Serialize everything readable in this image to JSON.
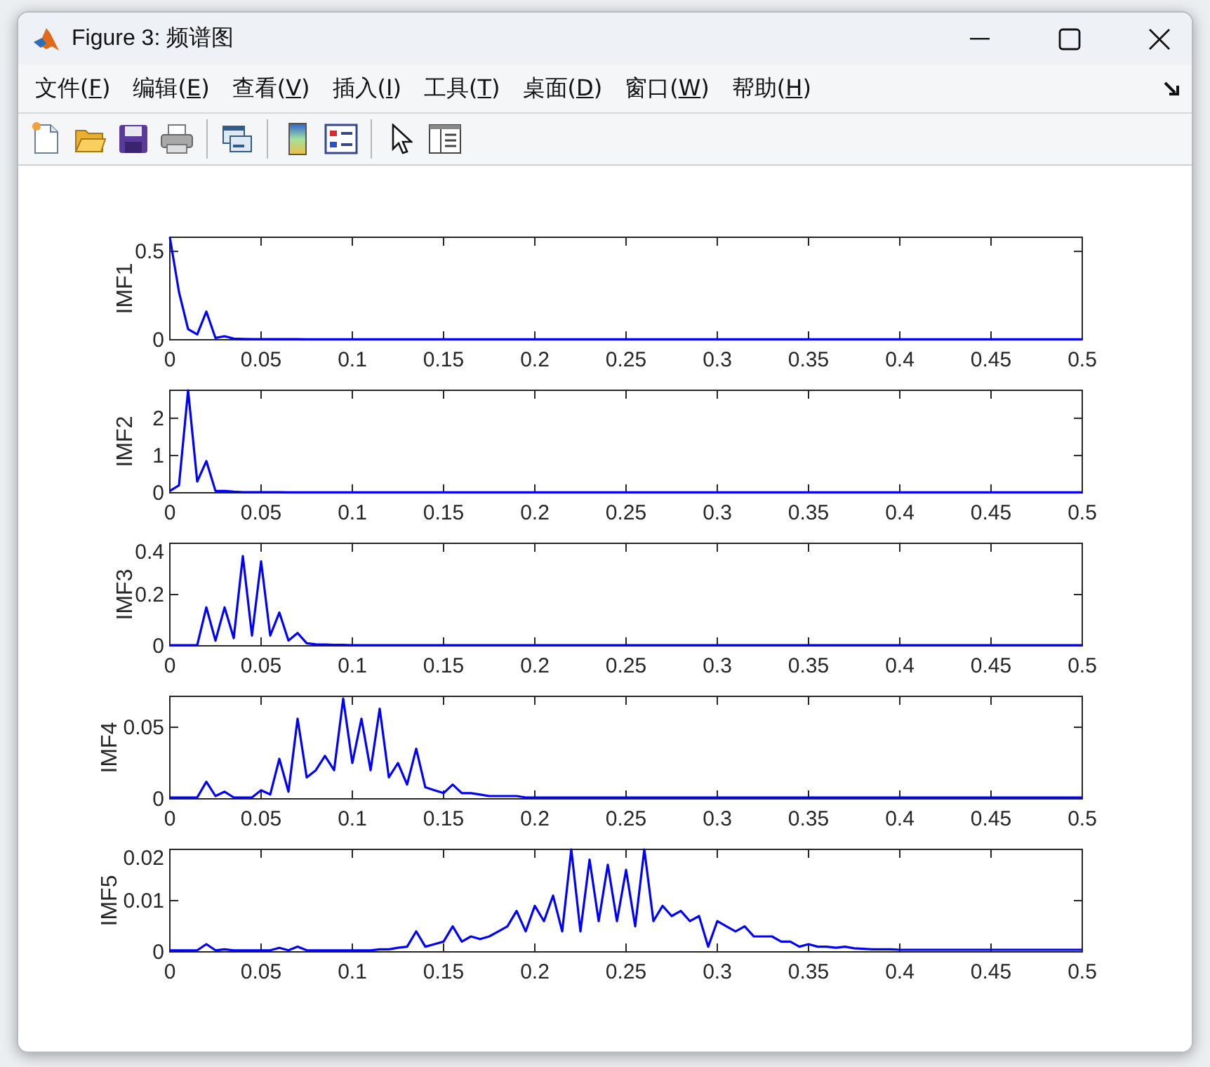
{
  "window": {
    "title": "Figure 3: 频谱图"
  },
  "menu": [
    {
      "label": "文件(F)"
    },
    {
      "label": "编辑(E)"
    },
    {
      "label": "查看(V)"
    },
    {
      "label": "插入(I)"
    },
    {
      "label": "工具(T)"
    },
    {
      "label": "桌面(D)"
    },
    {
      "label": "窗口(W)"
    },
    {
      "label": "帮助(H)"
    }
  ],
  "toolbar": [
    {
      "kind": "new"
    },
    {
      "kind": "open"
    },
    {
      "kind": "save"
    },
    {
      "kind": "print"
    },
    {
      "kind": "separator"
    },
    {
      "kind": "link"
    },
    {
      "kind": "separator"
    },
    {
      "kind": "colorbar"
    },
    {
      "kind": "legend"
    },
    {
      "kind": "separator"
    },
    {
      "kind": "pointer"
    },
    {
      "kind": "inspector"
    }
  ],
  "plots": [
    {
      "chart_data": {
        "type": "line",
        "ylabel": "IMF1",
        "xlim": [
          0,
          0.5
        ],
        "ylim": [
          0,
          0.58
        ],
        "xticks": [
          0,
          0.05,
          0.1,
          0.15,
          0.2,
          0.25,
          0.3,
          0.35,
          0.4,
          0.45,
          0.5
        ],
        "yticks": [
          0,
          0.5
        ],
        "x": [
          0,
          0.005,
          0.01,
          0.015,
          0.02,
          0.025,
          0.03,
          0.035,
          0.04,
          0.045,
          0.05,
          0.055,
          0.06,
          0.065,
          0.07,
          0.075,
          0.08,
          0.085,
          0.09,
          0.095,
          0.1,
          0.105,
          0.11,
          0.115,
          0.12,
          0.125,
          0.13,
          0.135,
          0.14,
          0.145,
          0.15,
          0.155,
          0.16,
          0.165,
          0.17,
          0.175,
          0.18,
          0.185,
          0.19,
          0.195,
          0.2,
          0.205,
          0.21,
          0.215,
          0.22,
          0.225,
          0.23,
          0.235,
          0.24,
          0.245,
          0.25,
          0.255,
          0.26,
          0.265,
          0.27,
          0.275,
          0.28,
          0.285,
          0.29,
          0.295,
          0.3,
          0.305,
          0.31,
          0.315,
          0.32,
          0.325,
          0.33,
          0.335,
          0.34,
          0.345,
          0.35,
          0.355,
          0.36,
          0.365,
          0.37,
          0.375,
          0.38,
          0.385,
          0.39,
          0.395,
          0.4,
          0.405,
          0.41,
          0.415,
          0.42,
          0.425,
          0.43,
          0.435,
          0.44,
          0.445,
          0.45,
          0.455,
          0.46,
          0.465,
          0.47,
          0.475,
          0.48,
          0.485,
          0.49,
          0.495,
          0.5
        ],
        "series": [
          {
            "color": "#0000ff",
            "values": [
              0.58,
              0.27,
              0.06,
              0.03,
              0.16,
              0.01,
              0.02,
              0.006,
              0.005,
              0.004,
              0.004,
              0.003,
              0.003,
              0.003,
              0.003,
              0.002,
              0.002,
              0.002,
              0.002,
              0.002,
              0.002,
              0.002,
              0.002,
              0.002,
              0.002,
              0.002,
              0.002,
              0.002,
              0.002,
              0.002,
              0.002,
              0.002,
              0.002,
              0.002,
              0.002,
              0.002,
              0.002,
              0.002,
              0.002,
              0.002,
              0.002,
              0.002,
              0.002,
              0.002,
              0.002,
              0.002,
              0.002,
              0.002,
              0.002,
              0.002,
              0.002,
              0.002,
              0.002,
              0.002,
              0.002,
              0.002,
              0.002,
              0.002,
              0.002,
              0.002,
              0.002,
              0.002,
              0.002,
              0.002,
              0.002,
              0.002,
              0.002,
              0.002,
              0.002,
              0.002,
              0.002,
              0.002,
              0.002,
              0.002,
              0.002,
              0.002,
              0.002,
              0.002,
              0.002,
              0.002,
              0.002,
              0.002,
              0.002,
              0.002,
              0.002,
              0.002,
              0.002,
              0.002,
              0.002,
              0.002,
              0.002,
              0.002,
              0.002,
              0.002,
              0.002,
              0.002,
              0.002,
              0.002,
              0.002,
              0.002,
              0.002
            ]
          }
        ]
      }
    },
    {
      "chart_data": {
        "type": "line",
        "ylabel": "IMF2",
        "xlim": [
          0,
          0.5
        ],
        "ylim": [
          0,
          2.75
        ],
        "xticks": [
          0,
          0.05,
          0.1,
          0.15,
          0.2,
          0.25,
          0.3,
          0.35,
          0.4,
          0.45,
          0.5
        ],
        "yticks": [
          0,
          1,
          2
        ],
        "x": [
          0,
          0.005,
          0.01,
          0.015,
          0.02,
          0.025,
          0.03,
          0.035,
          0.04,
          0.045,
          0.05,
          0.055,
          0.06,
          0.065,
          0.07,
          0.075,
          0.08,
          0.085,
          0.09,
          0.095,
          0.1,
          0.105,
          0.11,
          0.115,
          0.12,
          0.125,
          0.13,
          0.135,
          0.14,
          0.145,
          0.15,
          0.155,
          0.16,
          0.165,
          0.17,
          0.175,
          0.18,
          0.185,
          0.19,
          0.195,
          0.2,
          0.205,
          0.21,
          0.215,
          0.22,
          0.225,
          0.23,
          0.235,
          0.24,
          0.245,
          0.25,
          0.255,
          0.26,
          0.265,
          0.27,
          0.275,
          0.28,
          0.285,
          0.29,
          0.295,
          0.3,
          0.305,
          0.31,
          0.315,
          0.32,
          0.325,
          0.33,
          0.335,
          0.34,
          0.345,
          0.35,
          0.355,
          0.36,
          0.365,
          0.37,
          0.375,
          0.38,
          0.385,
          0.39,
          0.395,
          0.4,
          0.405,
          0.41,
          0.415,
          0.42,
          0.425,
          0.43,
          0.435,
          0.44,
          0.445,
          0.45,
          0.455,
          0.46,
          0.465,
          0.47,
          0.475,
          0.48,
          0.485,
          0.49,
          0.495,
          0.5
        ],
        "series": [
          {
            "color": "#0000ff",
            "values": [
              0.05,
              0.2,
              2.75,
              0.3,
              0.85,
              0.05,
              0.05,
              0.03,
              0.02,
              0.02,
              0.02,
              0.02,
              0.02,
              0.01,
              0.01,
              0.01,
              0.01,
              0.01,
              0.01,
              0.01,
              0.01,
              0.01,
              0.01,
              0.01,
              0.01,
              0.01,
              0.01,
              0.01,
              0.01,
              0.01,
              0.01,
              0.01,
              0.01,
              0.01,
              0.01,
              0.01,
              0.01,
              0.01,
              0.01,
              0.01,
              0.01,
              0.01,
              0.01,
              0.01,
              0.01,
              0.01,
              0.01,
              0.01,
              0.01,
              0.01,
              0.01,
              0.01,
              0.01,
              0.01,
              0.01,
              0.01,
              0.01,
              0.01,
              0.01,
              0.01,
              0.01,
              0.01,
              0.01,
              0.01,
              0.01,
              0.01,
              0.01,
              0.01,
              0.01,
              0.01,
              0.01,
              0.01,
              0.01,
              0.01,
              0.01,
              0.01,
              0.01,
              0.01,
              0.01,
              0.01,
              0.01,
              0.01,
              0.01,
              0.01,
              0.01,
              0.01,
              0.01,
              0.01,
              0.01,
              0.01,
              0.01,
              0.01,
              0.01,
              0.01,
              0.01,
              0.01,
              0.01,
              0.01,
              0.01,
              0.01,
              0.01
            ]
          }
        ]
      }
    },
    {
      "chart_data": {
        "type": "line",
        "ylabel": "IMF3",
        "xlim": [
          0,
          0.5
        ],
        "ylim": [
          0,
          0.4
        ],
        "xticks": [
          0,
          0.05,
          0.1,
          0.15,
          0.2,
          0.25,
          0.3,
          0.35,
          0.4,
          0.45,
          0.5
        ],
        "yticks": [
          0,
          0.2,
          0.4
        ],
        "x": [
          0,
          0.005,
          0.01,
          0.015,
          0.02,
          0.025,
          0.03,
          0.035,
          0.04,
          0.045,
          0.05,
          0.055,
          0.06,
          0.065,
          0.07,
          0.075,
          0.08,
          0.085,
          0.09,
          0.095,
          0.1,
          0.105,
          0.11,
          0.115,
          0.12,
          0.125,
          0.13,
          0.135,
          0.14,
          0.145,
          0.15,
          0.155,
          0.16,
          0.165,
          0.17,
          0.175,
          0.18,
          0.185,
          0.19,
          0.195,
          0.2,
          0.205,
          0.21,
          0.215,
          0.22,
          0.225,
          0.23,
          0.235,
          0.24,
          0.245,
          0.25,
          0.255,
          0.26,
          0.265,
          0.27,
          0.275,
          0.28,
          0.285,
          0.29,
          0.295,
          0.3,
          0.305,
          0.31,
          0.315,
          0.32,
          0.325,
          0.33,
          0.335,
          0.34,
          0.345,
          0.35,
          0.355,
          0.36,
          0.365,
          0.37,
          0.375,
          0.38,
          0.385,
          0.39,
          0.395,
          0.4,
          0.405,
          0.41,
          0.415,
          0.42,
          0.425,
          0.43,
          0.435,
          0.44,
          0.445,
          0.45,
          0.455,
          0.46,
          0.465,
          0.47,
          0.475,
          0.48,
          0.485,
          0.49,
          0.495,
          0.5
        ],
        "series": [
          {
            "color": "#0000ff",
            "values": [
              0.003,
              0.003,
              0.003,
              0.003,
              0.15,
              0.02,
              0.15,
              0.03,
              0.35,
              0.04,
              0.33,
              0.04,
              0.13,
              0.02,
              0.05,
              0.01,
              0.006,
              0.005,
              0.004,
              0.004,
              0.003,
              0.003,
              0.003,
              0.003,
              0.003,
              0.003,
              0.003,
              0.003,
              0.003,
              0.003,
              0.003,
              0.003,
              0.003,
              0.003,
              0.003,
              0.003,
              0.003,
              0.003,
              0.003,
              0.003,
              0.003,
              0.003,
              0.003,
              0.003,
              0.003,
              0.003,
              0.003,
              0.003,
              0.003,
              0.003,
              0.003,
              0.003,
              0.003,
              0.003,
              0.003,
              0.003,
              0.003,
              0.003,
              0.003,
              0.003,
              0.003,
              0.003,
              0.003,
              0.003,
              0.003,
              0.003,
              0.003,
              0.003,
              0.003,
              0.003,
              0.003,
              0.003,
              0.003,
              0.003,
              0.003,
              0.003,
              0.003,
              0.003,
              0.003,
              0.003,
              0.003,
              0.003,
              0.003,
              0.003,
              0.003,
              0.003,
              0.003,
              0.003,
              0.003,
              0.003,
              0.003,
              0.003,
              0.003,
              0.003,
              0.003,
              0.003,
              0.003,
              0.003,
              0.003,
              0.003,
              0.003
            ]
          }
        ]
      }
    },
    {
      "chart_data": {
        "type": "line",
        "ylabel": "IMF4",
        "xlim": [
          0,
          0.5
        ],
        "ylim": [
          0,
          0.0716
        ],
        "xticks": [
          0,
          0.05,
          0.1,
          0.15,
          0.2,
          0.25,
          0.3,
          0.35,
          0.4,
          0.45,
          0.5
        ],
        "yticks": [
          0,
          0.05
        ],
        "x": [
          0,
          0.005,
          0.01,
          0.015,
          0.02,
          0.025,
          0.03,
          0.035,
          0.04,
          0.045,
          0.05,
          0.055,
          0.06,
          0.065,
          0.07,
          0.075,
          0.08,
          0.085,
          0.09,
          0.095,
          0.1,
          0.105,
          0.11,
          0.115,
          0.12,
          0.125,
          0.13,
          0.135,
          0.14,
          0.145,
          0.15,
          0.155,
          0.16,
          0.165,
          0.17,
          0.175,
          0.18,
          0.185,
          0.19,
          0.195,
          0.2,
          0.205,
          0.21,
          0.215,
          0.22,
          0.225,
          0.23,
          0.235,
          0.24,
          0.245,
          0.25,
          0.255,
          0.26,
          0.265,
          0.27,
          0.275,
          0.28,
          0.285,
          0.29,
          0.295,
          0.3,
          0.305,
          0.31,
          0.315,
          0.32,
          0.325,
          0.33,
          0.335,
          0.34,
          0.345,
          0.35,
          0.355,
          0.36,
          0.365,
          0.37,
          0.375,
          0.38,
          0.385,
          0.39,
          0.395,
          0.4,
          0.405,
          0.41,
          0.415,
          0.42,
          0.425,
          0.43,
          0.435,
          0.44,
          0.445,
          0.45,
          0.455,
          0.46,
          0.465,
          0.47,
          0.475,
          0.48,
          0.485,
          0.49,
          0.495,
          0.5
        ],
        "series": [
          {
            "color": "#0000ff",
            "values": [
              0.001,
              0.001,
              0.001,
              0.001,
              0.012,
              0.002,
              0.005,
              0.001,
              0.001,
              0.001,
              0.006,
              0.003,
              0.028,
              0.005,
              0.056,
              0.015,
              0.02,
              0.03,
              0.02,
              0.07,
              0.025,
              0.056,
              0.02,
              0.063,
              0.015,
              0.025,
              0.01,
              0.035,
              0.008,
              0.006,
              0.004,
              0.01,
              0.004,
              0.004,
              0.003,
              0.002,
              0.002,
              0.002,
              0.002,
              0.001,
              0.001,
              0.001,
              0.001,
              0.001,
              0.001,
              0.001,
              0.001,
              0.001,
              0.001,
              0.001,
              0.001,
              0.001,
              0.001,
              0.001,
              0.001,
              0.001,
              0.001,
              0.001,
              0.001,
              0.001,
              0.001,
              0.001,
              0.001,
              0.001,
              0.001,
              0.001,
              0.001,
              0.001,
              0.001,
              0.001,
              0.001,
              0.001,
              0.001,
              0.001,
              0.001,
              0.001,
              0.001,
              0.001,
              0.001,
              0.001,
              0.001,
              0.001,
              0.001,
              0.001,
              0.001,
              0.001,
              0.001,
              0.001,
              0.001,
              0.001,
              0.001,
              0.001,
              0.001,
              0.001,
              0.001,
              0.001,
              0.001,
              0.001,
              0.001,
              0.001,
              0.001
            ]
          }
        ]
      }
    },
    {
      "chart_data": {
        "type": "line",
        "ylabel": "IMF5",
        "xlim": [
          0,
          0.5
        ],
        "ylim": [
          0,
          0.02
        ],
        "xticks": [
          0,
          0.05,
          0.1,
          0.15,
          0.2,
          0.25,
          0.3,
          0.35,
          0.4,
          0.45,
          0.5
        ],
        "yticks": [
          0,
          0.01,
          0.02
        ],
        "x": [
          0,
          0.005,
          0.01,
          0.015,
          0.02,
          0.025,
          0.03,
          0.035,
          0.04,
          0.045,
          0.05,
          0.055,
          0.06,
          0.065,
          0.07,
          0.075,
          0.08,
          0.085,
          0.09,
          0.095,
          0.1,
          0.105,
          0.11,
          0.115,
          0.12,
          0.125,
          0.13,
          0.135,
          0.14,
          0.145,
          0.15,
          0.155,
          0.16,
          0.165,
          0.17,
          0.175,
          0.18,
          0.185,
          0.19,
          0.195,
          0.2,
          0.205,
          0.21,
          0.215,
          0.22,
          0.225,
          0.23,
          0.235,
          0.24,
          0.245,
          0.25,
          0.255,
          0.26,
          0.265,
          0.27,
          0.275,
          0.28,
          0.285,
          0.29,
          0.295,
          0.3,
          0.305,
          0.31,
          0.315,
          0.32,
          0.325,
          0.33,
          0.335,
          0.34,
          0.345,
          0.35,
          0.355,
          0.36,
          0.365,
          0.37,
          0.375,
          0.38,
          0.385,
          0.39,
          0.395,
          0.4,
          0.405,
          0.41,
          0.415,
          0.42,
          0.425,
          0.43,
          0.435,
          0.44,
          0.445,
          0.45,
          0.455,
          0.46,
          0.465,
          0.47,
          0.475,
          0.48,
          0.485,
          0.49,
          0.495,
          0.5
        ],
        "series": [
          {
            "color": "#0000ff",
            "values": [
              0.0003,
              0.0003,
              0.0003,
              0.0003,
              0.0015,
              0.0003,
              0.0005,
              0.0003,
              0.0003,
              0.0003,
              0.0003,
              0.0003,
              0.0008,
              0.0003,
              0.001,
              0.0003,
              0.0003,
              0.0003,
              0.0003,
              0.0003,
              0.0003,
              0.0003,
              0.0003,
              0.0005,
              0.0005,
              0.0008,
              0.001,
              0.004,
              0.001,
              0.0015,
              0.002,
              0.005,
              0.002,
              0.003,
              0.0025,
              0.003,
              0.004,
              0.005,
              0.008,
              0.004,
              0.009,
              0.006,
              0.011,
              0.004,
              0.02,
              0.004,
              0.018,
              0.006,
              0.017,
              0.006,
              0.016,
              0.005,
              0.02,
              0.006,
              0.009,
              0.007,
              0.008,
              0.006,
              0.007,
              0.001,
              0.006,
              0.005,
              0.004,
              0.005,
              0.003,
              0.003,
              0.003,
              0.002,
              0.002,
              0.001,
              0.0015,
              0.001,
              0.001,
              0.0008,
              0.001,
              0.0007,
              0.0006,
              0.0005,
              0.0005,
              0.0005,
              0.0004,
              0.0004,
              0.0004,
              0.0004,
              0.0004,
              0.0004,
              0.0004,
              0.0004,
              0.0004,
              0.0004,
              0.0004,
              0.0004,
              0.0004,
              0.0004,
              0.0004,
              0.0004,
              0.0004,
              0.0004,
              0.0004,
              0.0004,
              0.0004
            ]
          }
        ]
      }
    }
  ]
}
